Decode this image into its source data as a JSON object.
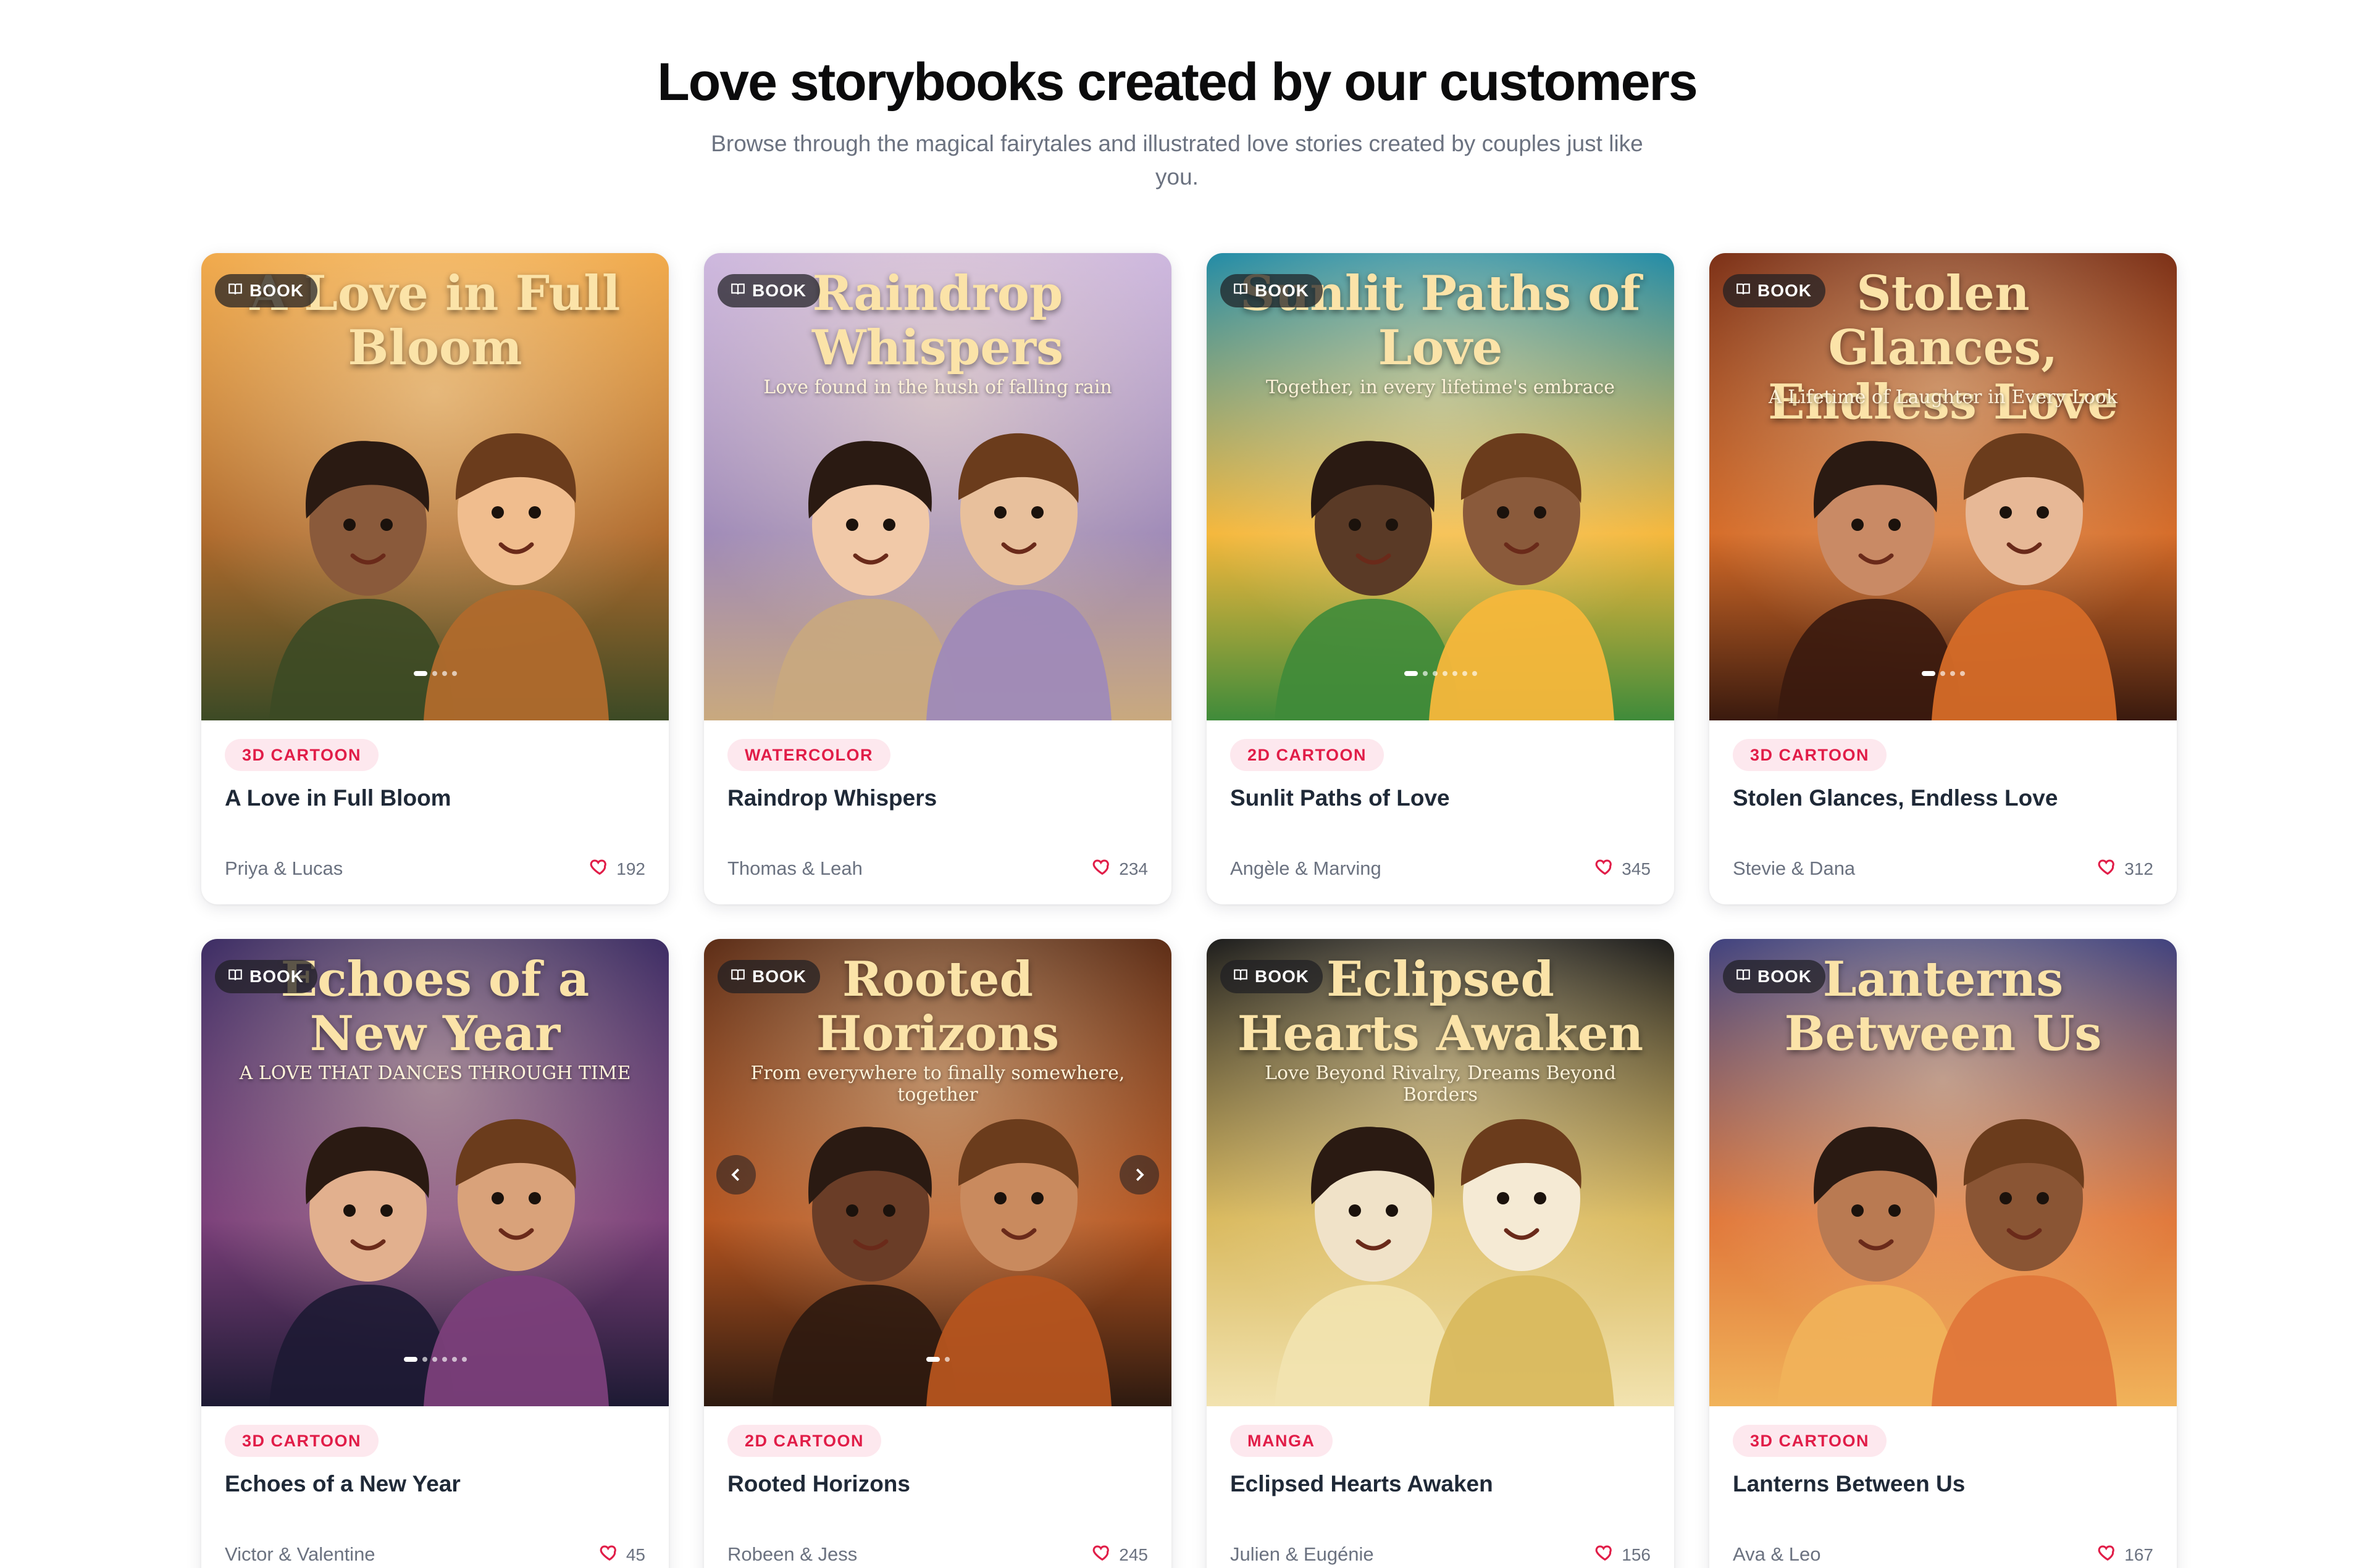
{
  "header": {
    "title": "Love storybooks created by our customers",
    "subtitle": "Browse through the magical fairytales and illustrated love stories created by couples just like you."
  },
  "colors": {
    "accent": "#e11d48",
    "tag_bg": "#fde8ee",
    "muted_text": "#6b7280"
  },
  "badge_label": "BOOK",
  "cards": [
    {
      "cover_title": "A Love in Full Bloom",
      "cover_subtitle": "",
      "style": "3D CARTOON",
      "title": "A Love in Full Bloom",
      "author": "Priya & Lucas",
      "likes": "192",
      "palette": [
        "#f1a94a",
        "#b06a2c",
        "#3c4a25"
      ],
      "slides": 4
    },
    {
      "cover_title": "Raindrop Whispers",
      "cover_subtitle": "Love found in the hush of falling rain",
      "style": "WATERCOLOR",
      "title": "Raindrop Whispers",
      "author": "Thomas & Leah",
      "likes": "234",
      "palette": [
        "#cdb7df",
        "#9f8ab8",
        "#c9a97e"
      ],
      "slides": 0
    },
    {
      "cover_title": "Sunlit Paths of Love",
      "cover_subtitle": "Together, in every lifetime's embrace",
      "style": "2D CARTOON",
      "title": "Sunlit Paths of Love",
      "author": "Angèle & Marving",
      "likes": "345",
      "palette": [
        "#1f8aa6",
        "#f5b73b",
        "#3f8b3a"
      ],
      "slides": 7
    },
    {
      "cover_title": "Stolen Glances, Endless Love",
      "cover_subtitle": "A Lifetime of Laughter in Every Look",
      "style": "3D CARTOON",
      "title": "Stolen Glances, Endless Love",
      "author": "Stevie & Dana",
      "likes": "312",
      "palette": [
        "#7a2d14",
        "#d56b28",
        "#3a1a0e"
      ],
      "slides": 4
    },
    {
      "cover_title": "Echoes of a New Year",
      "cover_subtitle": "A LOVE THAT DANCES THROUGH TIME",
      "style": "3D CARTOON",
      "title": "Echoes of a New Year",
      "author": "Victor & Valentine",
      "likes": "45",
      "palette": [
        "#3a2a63",
        "#7b3f7a",
        "#1d1a33"
      ],
      "slides": 6
    },
    {
      "cover_title": "Rooted Horizons",
      "cover_subtitle": "From everywhere to finally somewhere, together",
      "style": "2D CARTOON",
      "title": "Rooted Horizons",
      "author": "Robeen & Jess",
      "likes": "245",
      "palette": [
        "#5a2a14",
        "#b5541f",
        "#2d1a10"
      ],
      "slides": 2
    },
    {
      "cover_title": "Eclipsed Hearts Awaken",
      "cover_subtitle": "Love Beyond Rivalry, Dreams Beyond Borders",
      "style": "MANGA",
      "title": "Eclipsed Hearts Awaken",
      "author": "Julien & Eugénie",
      "likes": "156",
      "palette": [
        "#1a1a1a",
        "#d9b95e",
        "#f2e3b0"
      ],
      "slides": 0
    },
    {
      "cover_title": "Lanterns Between Us",
      "cover_subtitle": "",
      "style": "3D CARTOON",
      "title": "Lanterns Between Us",
      "author": "Ava & Leo",
      "likes": "167",
      "palette": [
        "#3d3f7d",
        "#e0773a",
        "#f1b35a"
      ],
      "slides": 0
    }
  ]
}
